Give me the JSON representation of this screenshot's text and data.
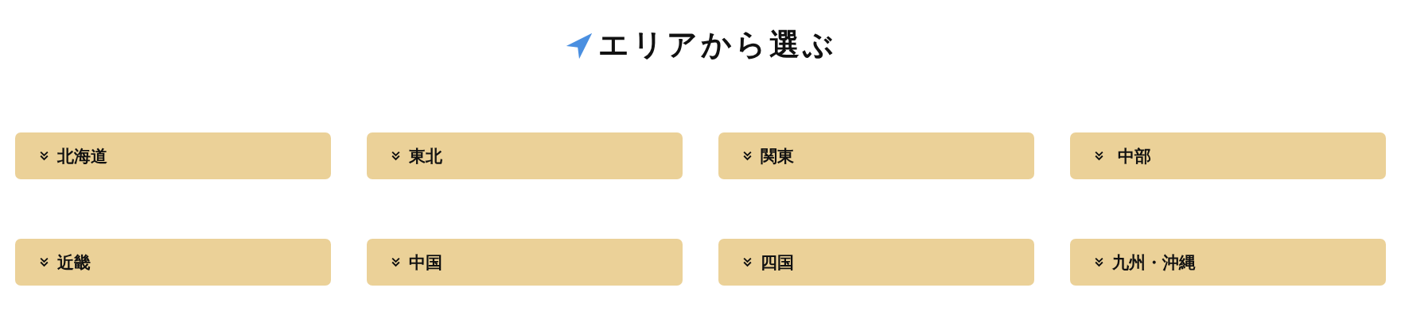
{
  "heading": {
    "title": "エリアから選ぶ"
  },
  "areas": [
    {
      "label": "北海道"
    },
    {
      "label": "東北"
    },
    {
      "label": "関東"
    },
    {
      "label": " 中部"
    },
    {
      "label": "近畿"
    },
    {
      "label": "中国"
    },
    {
      "label": "四国"
    },
    {
      "label": "九州・沖縄"
    }
  ]
}
